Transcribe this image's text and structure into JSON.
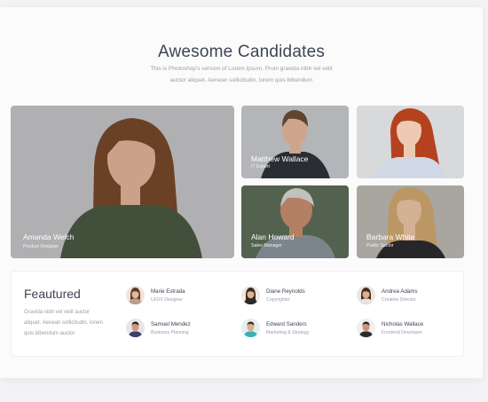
{
  "header": {
    "title": "Awesome Candidates",
    "subtitle_line1": "This is Photoshop's version  of Lorem Ipsum. Proin gravida nibh vel velit",
    "subtitle_line2": "auctor aliquet. Aenean sollicitudin, lorem quis bibendum"
  },
  "candidates": [
    {
      "name": "Amanda Welch",
      "role": "Product Designer",
      "bg": "#c9c9cb",
      "hair": "#7a4a2c",
      "skin": "#e8b99d",
      "shirt": "#4a5a44"
    },
    {
      "name": "Matthew Wallace",
      "role": "IT Expert",
      "bg": "#c4c5c8",
      "hair": "#6a4a32",
      "skin": "#e0b397",
      "shirt": "#2e3138"
    },
    {
      "name": "",
      "role": "",
      "bg": "#d8d9db",
      "hair": "#b5421f",
      "skin": "#efcab3",
      "shirt": "#cfd8e4"
    },
    {
      "name": "Alan Howard",
      "role": "Sales Manager",
      "bg": "#5d6e58",
      "hair": "#d7d7d4",
      "skin": "#c98f6f",
      "shirt": "#8b939c"
    },
    {
      "name": "Barbara White",
      "role": "Public Sector",
      "bg": "#b7b5ad",
      "hair": "#caa46d",
      "skin": "#e6bfa2",
      "shirt": "#2b2b2d"
    }
  ],
  "featured": {
    "title": "Feautured",
    "text_line1": "Gravida nibh vel velit auctor",
    "text_line2": "aliquet. Aenean sollicitudin, lorem",
    "text_line3": "quis bibendum auctor",
    "people": [
      {
        "name": "Marie Estrada",
        "role": "UI/UX Designer",
        "icon": "woman-avatar-icon",
        "bg": "#f0e4da",
        "hair": "#5b3a24",
        "skin": "#e6b79a",
        "shirt": "#b9a08d"
      },
      {
        "name": "Diane Reynolds",
        "role": "Copyrighter",
        "icon": "woman-avatar-icon",
        "bg": "#efe9e3",
        "hair": "#3a2a22",
        "skin": "#e2b394",
        "shirt": "#2b2b2b"
      },
      {
        "name": "Andrea Adams",
        "role": "Creative Director",
        "icon": "woman-avatar-icon",
        "bg": "#ece6e1",
        "hair": "#4a2e22",
        "skin": "#dfae8e",
        "shirt": "#e7e3de"
      },
      {
        "name": "Samuel Mendez",
        "role": "Business Planning",
        "icon": "man-avatar-icon",
        "bg": "#e9e4ea",
        "hair": "#2a2222",
        "skin": "#cf9a78",
        "shirt": "#3b3f6b"
      },
      {
        "name": "Edward Sanders",
        "role": "Marketing & Strategy",
        "icon": "man-avatar-icon",
        "bg": "#e7eef0",
        "hair": "#3a2c24",
        "skin": "#dcae8f",
        "shirt": "#3ab0b5"
      },
      {
        "name": "Nicholas Wallace",
        "role": "Frontend Developer",
        "icon": "man-avatar-icon",
        "bg": "#efefef",
        "hair": "#2c221d",
        "skin": "#c99478",
        "shirt": "#2c2c30"
      }
    ]
  }
}
